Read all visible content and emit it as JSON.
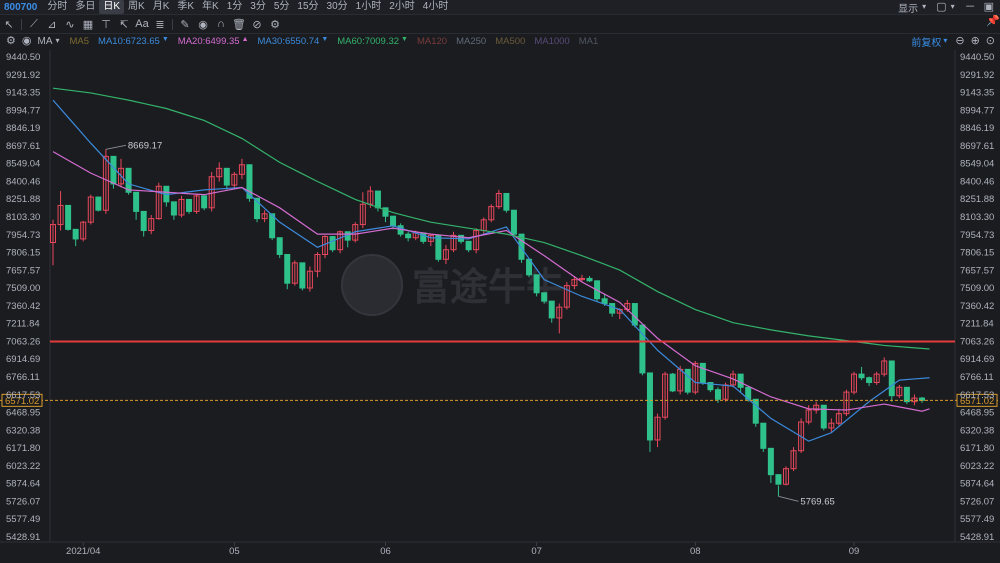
{
  "header": {
    "symbol": "800700",
    "periods": [
      "分时",
      "多日",
      "日K",
      "周K",
      "月K",
      "季K",
      "年K",
      "1分",
      "3分",
      "5分",
      "15分",
      "30分",
      "1小时",
      "2小时",
      "4小时"
    ],
    "selected_period": "日K",
    "display_label": "显示"
  },
  "indicators": {
    "type_label": "MA",
    "items": [
      {
        "label": "MA5",
        "color": "#7c6a2f"
      },
      {
        "label": "MA10:6723.65",
        "color": "#3c8bdc"
      },
      {
        "label": "MA20:6499.35",
        "color": "#d46cd1"
      },
      {
        "label": "MA30:6550.74",
        "color": "#3c8bdc"
      },
      {
        "label": "MA60:7009.32",
        "color": "#33b36b"
      },
      {
        "label": "MA120",
        "color": "#7a3b3b"
      },
      {
        "label": "MA250",
        "color": "#5e6a78"
      },
      {
        "label": "MA500",
        "color": "#6a5a3a"
      },
      {
        "label": "MA1000",
        "color": "#5a4a78"
      },
      {
        "label": "MA1",
        "color": "#4e5560"
      }
    ],
    "adjust_label": "前复权"
  },
  "colors": {
    "up": "#e8485c",
    "down": "#2fc18b",
    "ma10": "#3c8bdc",
    "ma20": "#d46cd1",
    "ma60": "#33b36b",
    "hline": "#e23b3b",
    "current": "#d89a2c"
  },
  "watermark": "富途牛牛",
  "chart_data": {
    "type": "candlestick",
    "y_ticks": [
      9440.5,
      9291.92,
      9143.35,
      8994.77,
      8846.19,
      8697.61,
      8549.04,
      8400.46,
      8251.88,
      8103.3,
      7954.73,
      7806.15,
      7657.57,
      7509.0,
      7360.42,
      7211.84,
      7063.26,
      6914.69,
      6766.11,
      6617.53,
      6468.95,
      6320.38,
      6171.8,
      6023.22,
      5874.64,
      5726.07,
      5577.49,
      5428.91
    ],
    "x_ticks": [
      {
        "label": "2021/04",
        "index": 4
      },
      {
        "label": "05",
        "index": 24
      },
      {
        "label": "06",
        "index": 44
      },
      {
        "label": "07",
        "index": 64
      },
      {
        "label": "08",
        "index": 85
      },
      {
        "label": "09",
        "index": 106
      }
    ],
    "max_label": "8669.17",
    "min_label": "5769.65",
    "current_value": "6571.02",
    "resistance_level": 7063.26,
    "candles": [
      [
        7890,
        8080,
        7700,
        8040
      ],
      [
        8040,
        8320,
        7990,
        8200
      ],
      [
        8200,
        8080,
        7990,
        8000
      ],
      [
        8000,
        7980,
        7860,
        7920
      ],
      [
        7920,
        8070,
        7900,
        8060
      ],
      [
        8060,
        8290,
        8040,
        8270
      ],
      [
        8270,
        8220,
        8150,
        8160
      ],
      [
        8160,
        8669,
        8130,
        8610
      ],
      [
        8610,
        8480,
        8340,
        8380
      ],
      [
        8380,
        8590,
        8350,
        8510
      ],
      [
        8510,
        8420,
        8290,
        8310
      ],
      [
        8310,
        8270,
        8080,
        8150
      ],
      [
        8150,
        8070,
        7940,
        7990
      ],
      [
        7990,
        8120,
        7960,
        8090
      ],
      [
        8090,
        8390,
        8080,
        8360
      ],
      [
        8360,
        8310,
        8190,
        8230
      ],
      [
        8230,
        8150,
        8080,
        8120
      ],
      [
        8120,
        8280,
        8100,
        8250
      ],
      [
        8250,
        8170,
        8130,
        8150
      ],
      [
        8150,
        8300,
        8130,
        8280
      ],
      [
        8280,
        8190,
        8160,
        8180
      ],
      [
        8180,
        8480,
        8150,
        8440
      ],
      [
        8440,
        8560,
        8400,
        8510
      ],
      [
        8510,
        8430,
        8330,
        8370
      ],
      [
        8370,
        8480,
        8350,
        8460
      ],
      [
        8460,
        8590,
        8420,
        8540
      ],
      [
        8540,
        8360,
        8230,
        8260
      ],
      [
        8260,
        8220,
        8060,
        8090
      ],
      [
        8090,
        8160,
        8060,
        8130
      ],
      [
        8130,
        8070,
        7910,
        7930
      ],
      [
        7930,
        7870,
        7760,
        7790
      ],
      [
        7790,
        7690,
        7500,
        7550
      ],
      [
        7550,
        7740,
        7530,
        7720
      ],
      [
        7720,
        7660,
        7490,
        7510
      ],
      [
        7510,
        7690,
        7480,
        7650
      ],
      [
        7650,
        7810,
        7600,
        7790
      ],
      [
        7790,
        7950,
        7760,
        7940
      ],
      [
        7940,
        7880,
        7810,
        7830
      ],
      [
        7830,
        7990,
        7800,
        7980
      ],
      [
        7980,
        7960,
        7850,
        7910
      ],
      [
        7910,
        8060,
        7890,
        8040
      ],
      [
        8040,
        8310,
        8010,
        8210
      ],
      [
        8210,
        8360,
        8180,
        8320
      ],
      [
        8320,
        8250,
        8150,
        8180
      ],
      [
        8180,
        8180,
        8060,
        8110
      ],
      [
        8110,
        8100,
        8000,
        8030
      ],
      [
        8030,
        8050,
        7940,
        7960
      ],
      [
        7960,
        7980,
        7900,
        7930
      ],
      [
        7930,
        7990,
        7910,
        7970
      ],
      [
        7970,
        7940,
        7880,
        7900
      ],
      [
        7900,
        7960,
        7860,
        7950
      ],
      [
        7950,
        7870,
        7730,
        7750
      ],
      [
        7750,
        7870,
        7710,
        7830
      ],
      [
        7830,
        7980,
        7810,
        7950
      ],
      [
        7950,
        7930,
        7880,
        7900
      ],
      [
        7900,
        7880,
        7810,
        7830
      ],
      [
        7830,
        8010,
        7800,
        7990
      ],
      [
        7990,
        8100,
        7960,
        8080
      ],
      [
        8080,
        8210,
        8060,
        8190
      ],
      [
        8190,
        8330,
        8170,
        8300
      ],
      [
        8300,
        8250,
        8140,
        8160
      ],
      [
        8160,
        8090,
        7940,
        7960
      ],
      [
        7960,
        7840,
        7720,
        7750
      ],
      [
        7750,
        7680,
        7600,
        7620
      ],
      [
        7620,
        7560,
        7440,
        7470
      ],
      [
        7470,
        7440,
        7380,
        7400
      ],
      [
        7400,
        7330,
        7220,
        7260
      ],
      [
        7260,
        7380,
        7130,
        7350
      ],
      [
        7350,
        7560,
        7330,
        7530
      ],
      [
        7530,
        7610,
        7500,
        7580
      ],
      [
        7580,
        7620,
        7560,
        7590
      ],
      [
        7590,
        7610,
        7560,
        7570
      ],
      [
        7570,
        7520,
        7400,
        7420
      ],
      [
        7420,
        7460,
        7360,
        7380
      ],
      [
        7380,
        7340,
        7270,
        7300
      ],
      [
        7300,
        7340,
        7250,
        7330
      ],
      [
        7330,
        7410,
        7310,
        7380
      ],
      [
        7380,
        7330,
        7180,
        7200
      ],
      [
        7200,
        7030,
        6780,
        6800
      ],
      [
        6800,
        6600,
        6140,
        6240
      ],
      [
        6240,
        6460,
        6180,
        6430
      ],
      [
        6430,
        6810,
        6410,
        6790
      ],
      [
        6790,
        6800,
        6640,
        6650
      ],
      [
        6650,
        6860,
        6620,
        6830
      ],
      [
        6830,
        6770,
        6620,
        6640
      ],
      [
        6640,
        6900,
        6620,
        6880
      ],
      [
        6880,
        6810,
        6700,
        6720
      ],
      [
        6720,
        6700,
        6640,
        6660
      ],
      [
        6660,
        6680,
        6550,
        6580
      ],
      [
        6580,
        6720,
        6560,
        6700
      ],
      [
        6700,
        6820,
        6680,
        6790
      ],
      [
        6790,
        6750,
        6640,
        6680
      ],
      [
        6680,
        6660,
        6560,
        6580
      ],
      [
        6580,
        6500,
        6350,
        6380
      ],
      [
        6380,
        6310,
        6140,
        6170
      ],
      [
        6170,
        6050,
        5880,
        5950
      ],
      [
        5950,
        5860,
        5769,
        5870
      ],
      [
        5870,
        6020,
        5860,
        6000
      ],
      [
        6000,
        6180,
        5980,
        6150
      ],
      [
        6150,
        6420,
        6130,
        6390
      ],
      [
        6390,
        6530,
        6370,
        6490
      ],
      [
        6490,
        6560,
        6460,
        6530
      ],
      [
        6530,
        6450,
        6320,
        6340
      ],
      [
        6340,
        6420,
        6300,
        6380
      ],
      [
        6380,
        6500,
        6360,
        6460
      ],
      [
        6460,
        6660,
        6440,
        6640
      ],
      [
        6640,
        6810,
        6620,
        6790
      ],
      [
        6790,
        6850,
        6740,
        6760
      ],
      [
        6760,
        6770,
        6690,
        6720
      ],
      [
        6720,
        6810,
        6700,
        6790
      ],
      [
        6790,
        6930,
        6770,
        6900
      ],
      [
        6900,
        6730,
        6560,
        6610
      ],
      [
        6610,
        6700,
        6590,
        6680
      ],
      [
        6680,
        6580,
        6540,
        6560
      ],
      [
        6560,
        6620,
        6530,
        6590
      ],
      [
        6590,
        6600,
        6550,
        6571
      ]
    ],
    "ma_series": [
      {
        "name": "MA10",
        "color": "#3c8bdc",
        "points": [
          [
            0,
            9080
          ],
          [
            5,
            8720
          ],
          [
            10,
            8380
          ],
          [
            15,
            8290
          ],
          [
            20,
            8330
          ],
          [
            25,
            8350
          ],
          [
            30,
            8060
          ],
          [
            35,
            7850
          ],
          [
            40,
            7980
          ],
          [
            45,
            8030
          ],
          [
            50,
            7930
          ],
          [
            55,
            7920
          ],
          [
            60,
            8020
          ],
          [
            65,
            7580
          ],
          [
            70,
            7440
          ],
          [
            75,
            7330
          ],
          [
            80,
            6990
          ],
          [
            85,
            6720
          ],
          [
            90,
            6690
          ],
          [
            95,
            6420
          ],
          [
            100,
            6230
          ],
          [
            103,
            6300
          ],
          [
            108,
            6560
          ],
          [
            112,
            6740
          ],
          [
            116,
            6760
          ]
        ]
      },
      {
        "name": "MA20",
        "color": "#d46cd1",
        "points": [
          [
            0,
            8650
          ],
          [
            5,
            8470
          ],
          [
            10,
            8330
          ],
          [
            15,
            8310
          ],
          [
            20,
            8290
          ],
          [
            25,
            8350
          ],
          [
            30,
            8180
          ],
          [
            35,
            7960
          ],
          [
            40,
            7960
          ],
          [
            45,
            8010
          ],
          [
            50,
            7960
          ],
          [
            55,
            7930
          ],
          [
            60,
            7990
          ],
          [
            65,
            7780
          ],
          [
            70,
            7560
          ],
          [
            75,
            7390
          ],
          [
            80,
            7090
          ],
          [
            85,
            6860
          ],
          [
            90,
            6750
          ],
          [
            95,
            6600
          ],
          [
            100,
            6500
          ],
          [
            105,
            6490
          ],
          [
            110,
            6540
          ],
          [
            115,
            6480
          ],
          [
            116,
            6500
          ]
        ]
      },
      {
        "name": "MA60",
        "color": "#33b36b",
        "points": [
          [
            0,
            9180
          ],
          [
            5,
            9140
          ],
          [
            10,
            9080
          ],
          [
            15,
            9010
          ],
          [
            20,
            8910
          ],
          [
            25,
            8760
          ],
          [
            30,
            8560
          ],
          [
            35,
            8400
          ],
          [
            40,
            8250
          ],
          [
            45,
            8140
          ],
          [
            50,
            8060
          ],
          [
            55,
            8010
          ],
          [
            60,
            7960
          ],
          [
            65,
            7890
          ],
          [
            70,
            7780
          ],
          [
            75,
            7660
          ],
          [
            80,
            7480
          ],
          [
            85,
            7330
          ],
          [
            90,
            7220
          ],
          [
            95,
            7160
          ],
          [
            100,
            7110
          ],
          [
            105,
            7070
          ],
          [
            110,
            7030
          ],
          [
            116,
            7000
          ]
        ]
      }
    ]
  }
}
